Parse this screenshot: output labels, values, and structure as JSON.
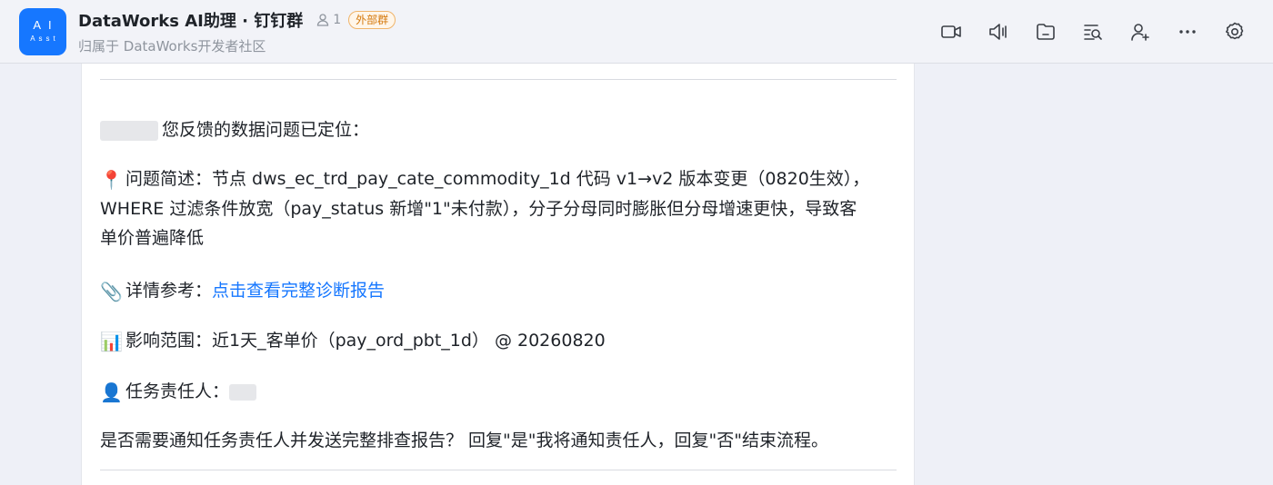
{
  "header": {
    "avatar": {
      "line1": "AI",
      "line2": "Asst",
      "color": "#1677ff"
    },
    "title": "DataWorks AI助理 · 钉钉群",
    "member_count": "1",
    "tag": "外部群",
    "subtitle": "归属于 DataWorks开发者社区",
    "tools": [
      "video-icon",
      "mute-icon",
      "folder-icon",
      "search-records-icon",
      "add-member-icon",
      "more-icon",
      "settings-icon"
    ]
  },
  "message": {
    "greeting": "您反馈的数据问题已定位：",
    "issue_emoji": "📍",
    "issue_line1": "问题简述：节点 dws_ec_trd_pay_cate_commodity_1d 代码 v1→v2 版本变更（0820生效），",
    "issue_line2": "WHERE 过滤条件放宽（pay_status 新增\"1\"未付款），分子分母同时膨胀但分母增速更快，导致客",
    "issue_line3": "单价普遍降低",
    "detail_emoji": "📎",
    "detail_label": "详情参考：",
    "detail_link": "点击查看完整诊断报告",
    "impact_emoji": "📊",
    "impact_text": "影响范围：近1天_客单价（pay_ord_pbt_1d） @ 20260820",
    "owner_emoji": "👤",
    "owner_label": "任务责任人：",
    "question": "是否需要通知任务责任人并发送完整排查报告？ 回复\"是\"我将通知责任人，回复\"否\"结束流程。"
  },
  "colors": {
    "accent": "#1677ff",
    "tag": "#d4780b",
    "link": "#1677ff"
  }
}
